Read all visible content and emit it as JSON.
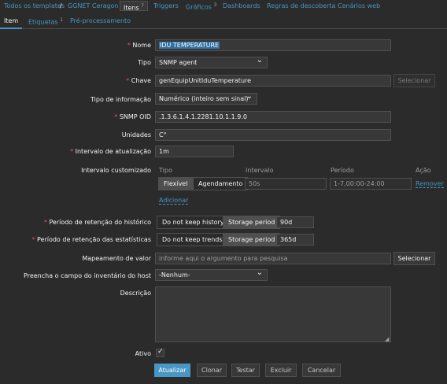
{
  "breadcrumbs": [
    {
      "label": "Todos os templates"
    },
    {
      "label": "GGNET Ceragon"
    },
    {
      "label": "Itens",
      "count": "7"
    },
    {
      "label": "Triggers"
    },
    {
      "label": "Gráficos",
      "count": "3"
    },
    {
      "label": "Dashboards"
    },
    {
      "label": "Regras de descoberta"
    },
    {
      "label": "Cenários web"
    }
  ],
  "separator": "/",
  "tabs": [
    {
      "label": "Item"
    },
    {
      "label": "Etiquetas",
      "count": "1"
    },
    {
      "label": "Pré-processamento"
    }
  ],
  "form": {
    "name": {
      "label": "Nome",
      "value": "IDU TEMPERATURE"
    },
    "type": {
      "label": "Tipo",
      "value": "SNMP agent"
    },
    "key": {
      "label": "Chave",
      "value": "genEquipUnitIduTemperature",
      "button": "Selecionar"
    },
    "info_type": {
      "label": "Tipo de informação",
      "value": "Numérico (inteiro sem sinal)"
    },
    "snmp_oid": {
      "label": "SNMP OID",
      "value": ".1.3.6.1.4.1.2281.10.1.1.9.0"
    },
    "units": {
      "label": "Unidades",
      "value": "C°"
    },
    "update_interval": {
      "label": "Intervalo de atualização",
      "value": "1m"
    },
    "custom_intervals": {
      "label": "Intervalo customizado",
      "headers": {
        "type": "Tipo",
        "interval": "Intervalo",
        "period": "Período",
        "action": "Ação"
      },
      "row": {
        "flexible": "Flexível",
        "scheduling": "Agendamento",
        "interval": "50s",
        "period": "1-7,00:00-24:00",
        "remove": "Remover"
      },
      "add": "Adicionar"
    },
    "history": {
      "label": "Período de retenção do histórico",
      "opt1": "Do not keep history",
      "opt2": "Storage period",
      "value": "90d"
    },
    "trends": {
      "label": "Período de retenção das estatísticas",
      "opt1": "Do not keep trends",
      "opt2": "Storage period",
      "value": "365d"
    },
    "valuemap": {
      "label": "Mapeamento de valor",
      "placeholder": "informe aqui o argumento para pesquisa",
      "button": "Selecionar"
    },
    "inventory": {
      "label": "Preencha o campo do inventário do host",
      "value": "-Nenhum-"
    },
    "description": {
      "label": "Descrição",
      "value": ""
    },
    "enabled": {
      "label": "Ativo",
      "checked": true
    }
  },
  "actions": {
    "update": "Atualizar",
    "clone": "Clonar",
    "test": "Testar",
    "delete": "Excluir",
    "cancel": "Cancelar"
  },
  "colors": {
    "accent": "#4796c4",
    "required": "#e45959",
    "background": "#2b2b2b",
    "field": "#383838"
  }
}
